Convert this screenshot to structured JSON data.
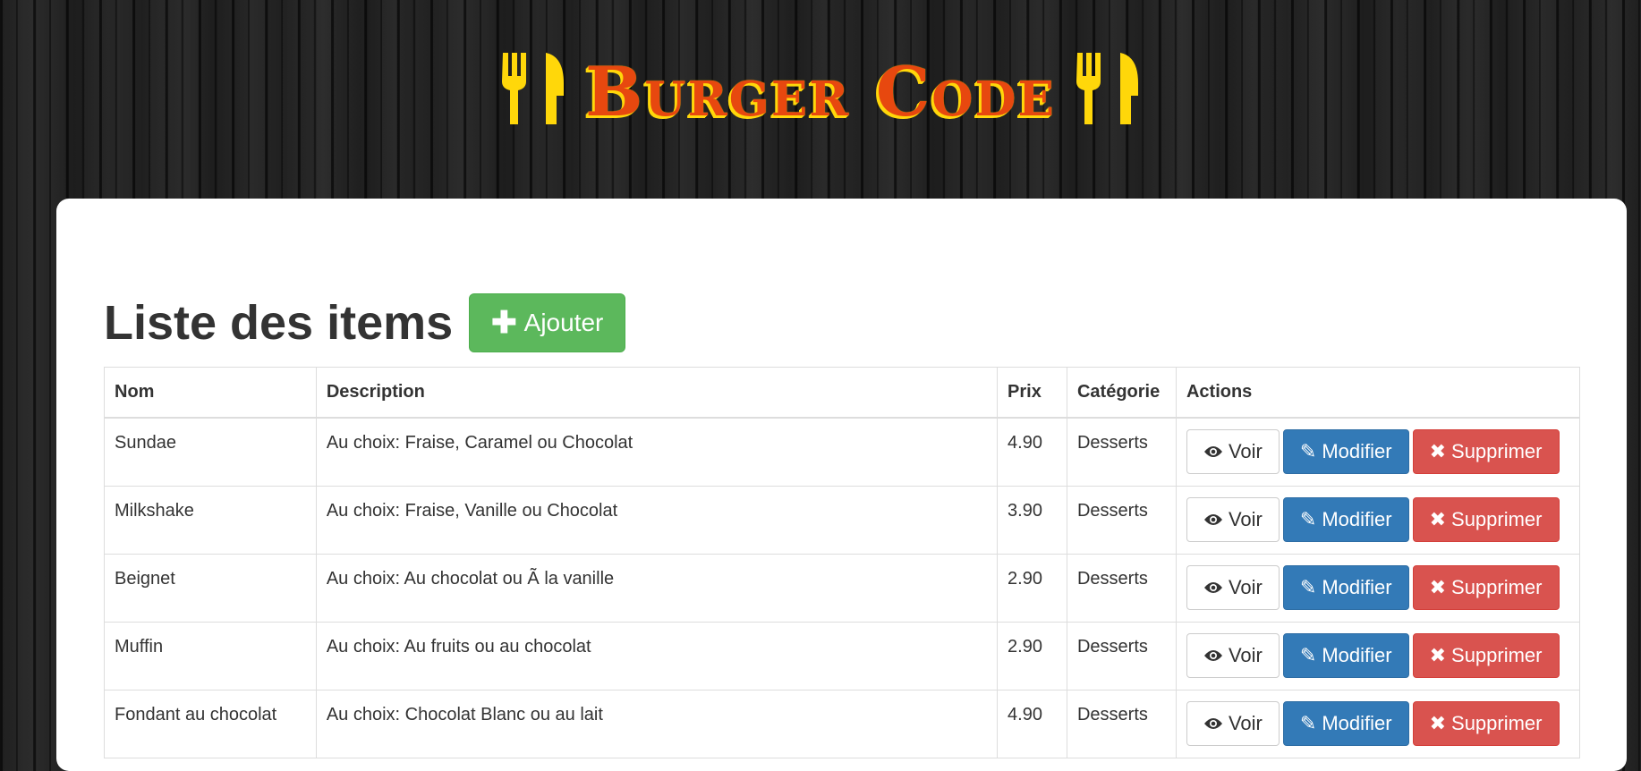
{
  "header": {
    "logo_text": "Burger Code",
    "logo_icon": "utensils-icon"
  },
  "page": {
    "title": "Liste des items",
    "add_button": "Ajouter",
    "add_icon": "plus-icon"
  },
  "table": {
    "columns": [
      "Nom",
      "Description",
      "Prix",
      "Catégorie",
      "Actions"
    ],
    "rows": [
      {
        "name": "Sundae",
        "description": "Au choix: Fraise, Caramel ou Chocolat",
        "price": "4.90",
        "category": "Desserts"
      },
      {
        "name": "Milkshake",
        "description": "Au choix: Fraise, Vanille ou Chocolat",
        "price": "3.90",
        "category": "Desserts"
      },
      {
        "name": "Beignet",
        "description": "Au choix: Au chocolat ou Ã  la vanille",
        "price": "2.90",
        "category": "Desserts"
      },
      {
        "name": "Muffin",
        "description": "Au choix: Au fruits ou au chocolat",
        "price": "2.90",
        "category": "Desserts"
      },
      {
        "name": "Fondant au chocolat",
        "description": "Au choix: Chocolat Blanc ou au lait",
        "price": "4.90",
        "category": "Desserts"
      }
    ],
    "actions": {
      "view": "Voir",
      "edit": "Modifier",
      "delete": "Supprimer"
    }
  },
  "colors": {
    "logo_text": "#e7480f",
    "logo_outline": "#ffd70a",
    "add_button": "#5cb85c",
    "edit_button": "#337ab7",
    "delete_button": "#d9534f"
  }
}
